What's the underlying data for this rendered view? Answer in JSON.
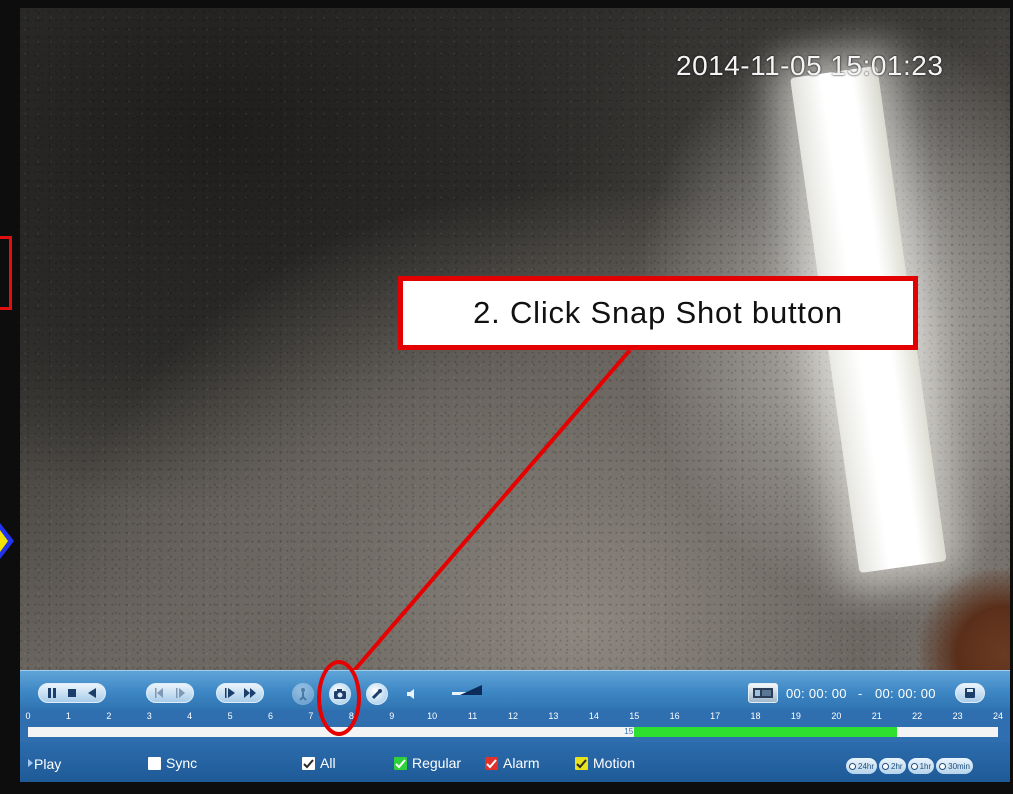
{
  "osd": {
    "timestamp": "2014-11-05 15:01:23"
  },
  "callout": {
    "text": "2. Click Snap Shot button"
  },
  "toolbar": {
    "time_start": "00: 00: 00",
    "time_sep": "-",
    "time_end": "00: 00: 00",
    "icons": [
      "pause-icon",
      "stop-icon",
      "play-backward-icon",
      "step-back-icon",
      "step-forward-icon",
      "slow-play-icon",
      "fast-forward-icon",
      "smart-search-icon",
      "snapshot-icon",
      "tag-icon",
      "volume-icon",
      "clip-icon",
      "save-icon"
    ]
  },
  "timeline": {
    "hours": [
      "0",
      "1",
      "2",
      "3",
      "4",
      "5",
      "6",
      "7",
      "8",
      "9",
      "10",
      "11",
      "12",
      "13",
      "14",
      "15",
      "16",
      "17",
      "18",
      "19",
      "20",
      "21",
      "22",
      "23",
      "24"
    ],
    "marker_label": "15",
    "recorded_from_hour": 15,
    "recorded_to_hour": 21.5,
    "record_color": "#2fe12f"
  },
  "bottom": {
    "play_label": "Play",
    "sync_label": "Sync",
    "all_label": "All",
    "regular_label": "Regular",
    "alarm_label": "Alarm",
    "motion_label": "Motion",
    "scales": [
      "24hr",
      "2hr",
      "1hr",
      "30min"
    ],
    "colors": {
      "regular": "#2fd13a",
      "alarm": "#e2302a",
      "motion": "#e8e21e"
    }
  },
  "accent_color": "#e30000"
}
